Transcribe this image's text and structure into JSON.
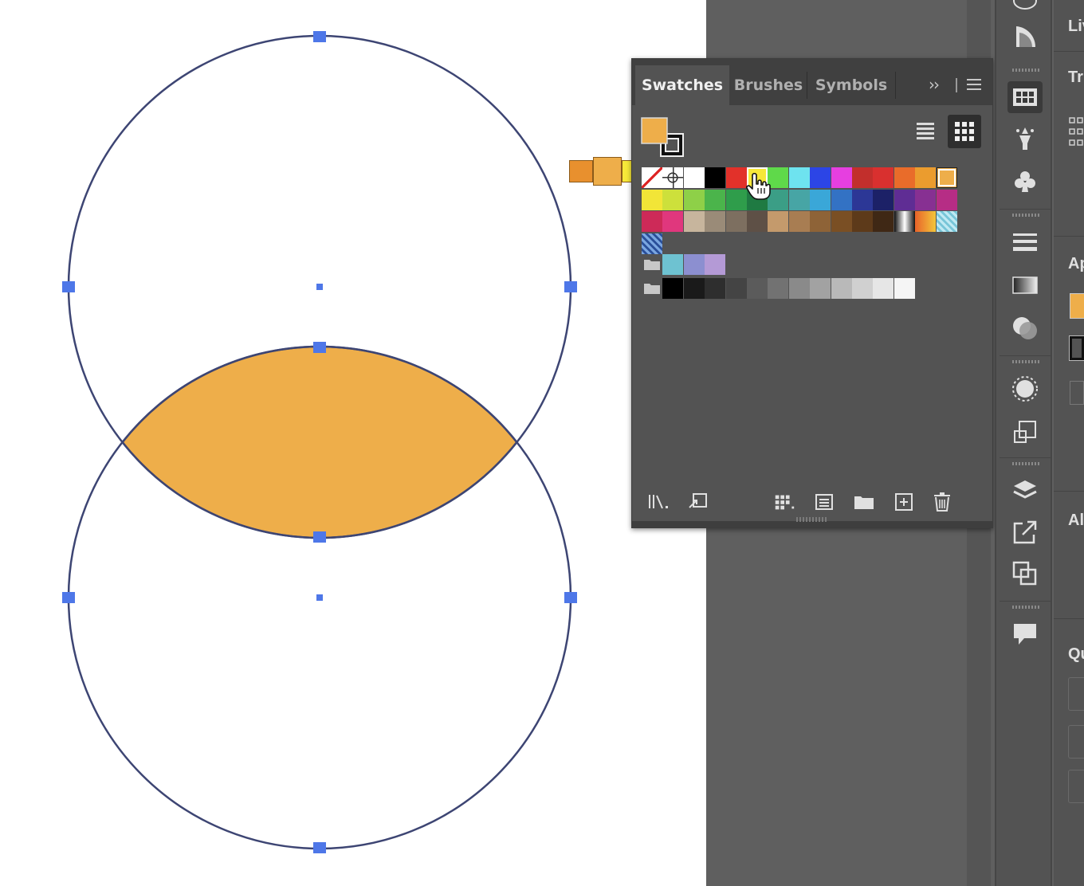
{
  "panel": {
    "tabs": [
      {
        "label": "Swatches",
        "active": true
      },
      {
        "label": "Brushes",
        "active": false
      },
      {
        "label": "Symbols",
        "active": false
      }
    ],
    "overflow_icon": "double-chevron-right",
    "menu_icon": "hamburger-menu",
    "fill_color": "#eeae4a",
    "stroke_color": "#111111",
    "view_modes": [
      "list-view",
      "thumbnail-view"
    ],
    "active_view": "thumbnail-view",
    "swatch_rows": [
      [
        "none",
        "registration",
        "#ffffff",
        "#000000",
        "#e2312a",
        "#f7e839",
        "#5fd94a",
        "#6ee3ef",
        "#2c45e6",
        "#e63fe0",
        "#c22f2c",
        "#d9302f",
        "#e96c2a",
        "#eb9c2e",
        "#eeae4a"
      ],
      [
        "#f2e537",
        "#cde03b",
        "#8ed048",
        "#4bb44b",
        "#2f9d4b",
        "#1f7a42",
        "#3b9e86",
        "#47a5a5",
        "#3aa7d8",
        "#3372c4",
        "#2c3796",
        "#1c2167",
        "#5f2d94",
        "#873092",
        "#b62d85"
      ],
      [
        "#cd2a58",
        "#e0377d",
        "#c7b59d",
        "#9a8b78",
        "#7d6f60",
        "#5e5046",
        "#c49a6c",
        "#a87d52",
        "#8e6337",
        "#7a4f24",
        "#5d3a1a",
        "#3f2815",
        "gradient-bw",
        "gradient-orange",
        "pattern-cyan"
      ],
      [
        "pattern-blue"
      ]
    ],
    "color_group_1": [
      "#6ec2d1",
      "#8c8fd0",
      "#b49ad6"
    ],
    "grayscale_group": [
      "#000000",
      "#1a1a1a",
      "#2e2e2e",
      "#444444",
      "#5b5b5b",
      "#727272",
      "#8a8a8a",
      "#a2a2a2",
      "#b9b9b9",
      "#d0d0d0",
      "#e6e6e6",
      "#f5f5f5"
    ],
    "selected_swatch": "#eeae4a",
    "hovered_swatch": "#f7e839",
    "bottom_icons": [
      "swatch-libraries-menu",
      "place-swatch-in-document",
      "show-swatch-kinds-menu",
      "swatch-options",
      "new-color-group",
      "new-swatch",
      "delete-swatch"
    ]
  },
  "drag_feedback": {
    "colors": [
      "#e8902e",
      "#eeae4a",
      "#f7e839"
    ]
  },
  "artwork": {
    "fill_color": "#eeae4a",
    "stroke_color": "#3d4573",
    "anchor_color": "#4e77e8"
  },
  "toolbar": {
    "icons": [
      "gradient-icon",
      "swatches-panel-icon",
      "symbol-sprayer-icon",
      "clubs-symbol-icon",
      "stroke-panel-icon",
      "gradient-panel-icon",
      "transparency-icon",
      "appearance-icon",
      "transform-icon",
      "layers-icon",
      "export-icon",
      "artboards-icon",
      "comments-icon"
    ],
    "active": "swatches-panel-icon"
  },
  "properties": {
    "labels": [
      "Liv",
      "Tr",
      "Ap",
      "Al",
      "Qu"
    ]
  }
}
